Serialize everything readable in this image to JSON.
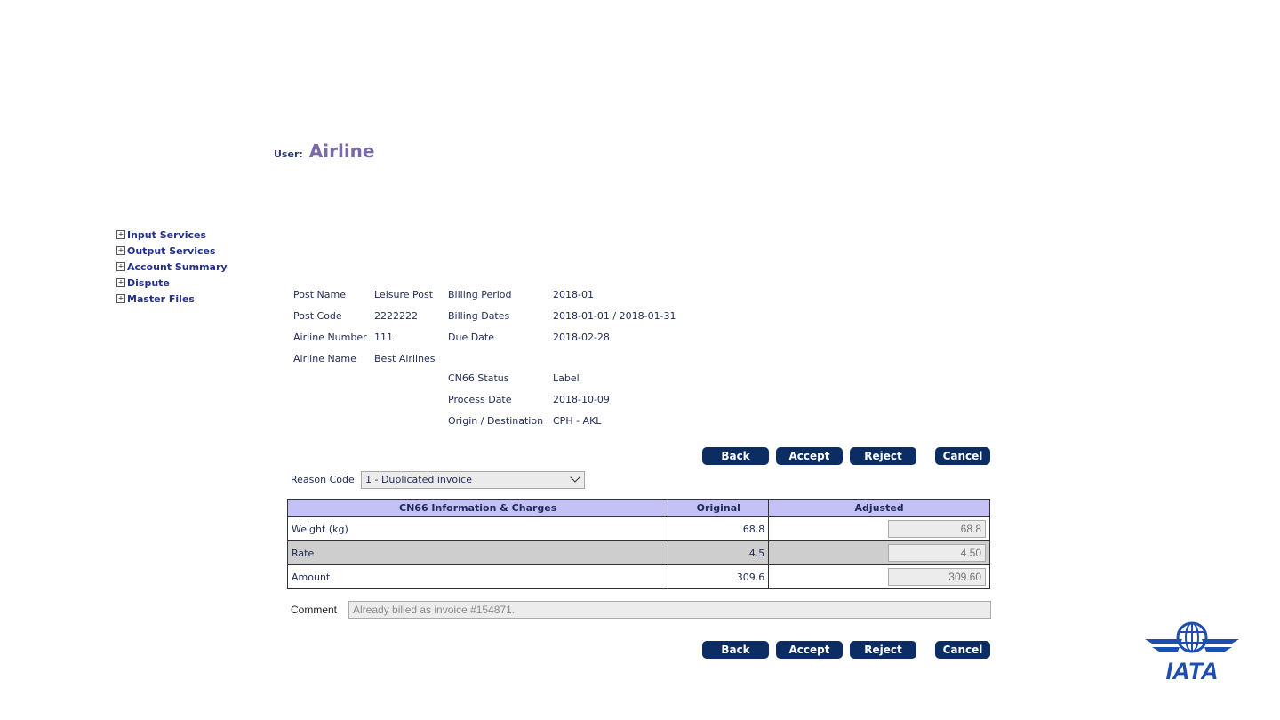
{
  "user": {
    "label": "User:",
    "name": "Airline"
  },
  "nav": [
    {
      "label": "Input Services"
    },
    {
      "label": "Output Services"
    },
    {
      "label": "Account Summary"
    },
    {
      "label": "Dispute"
    },
    {
      "label": "Master Files"
    }
  ],
  "info": {
    "post_name_label": "Post Name",
    "post_name": "Leisure Post",
    "post_code_label": "Post Code",
    "post_code": "2222222",
    "airline_number_label": "Airline Number",
    "airline_number": "111",
    "airline_name_label": "Airline Name",
    "airline_name": "Best Airlines",
    "billing_period_label": "Billing Period",
    "billing_period": "2018-01",
    "billing_dates_label": "Billing Dates",
    "billing_dates": "2018-01-01 / 2018-01-31",
    "due_date_label": "Due Date",
    "due_date": "2018-02-28",
    "cn66_status_label": "CN66 Status",
    "cn66_status": "Label",
    "process_date_label": "Process Date",
    "process_date": "2018-10-09",
    "origin_dest_label": "Origin / Destination",
    "origin_dest": "CPH - AKL"
  },
  "buttons": {
    "back": "Back",
    "accept": "Accept",
    "reject": "Reject",
    "cancel": "Cancel"
  },
  "reason": {
    "label": "Reason Code",
    "value": "1 - Duplicated invoice"
  },
  "table": {
    "headers": [
      "CN66 Information & Charges",
      "Original",
      "Adjusted"
    ],
    "rows": [
      {
        "label": "Weight (kg)",
        "original": "68.8",
        "adjusted": "68.8"
      },
      {
        "label": "Rate",
        "original": "4.5",
        "adjusted": "4.50"
      },
      {
        "label": "Amount",
        "original": "309.6",
        "adjusted": "309.60"
      }
    ]
  },
  "comment": {
    "label": "Comment",
    "value": "Already billed as invoice #154871."
  },
  "logo": {
    "text": "IATA",
    "icon": "iata-globe-wings-icon",
    "color": "#1d4fb0"
  }
}
